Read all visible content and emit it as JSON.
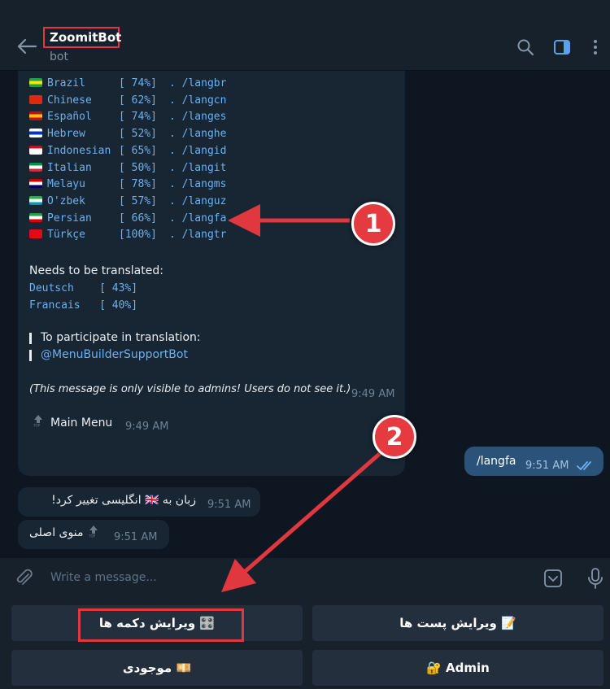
{
  "header": {
    "title": "ZoomitBot",
    "subtitle": "bot"
  },
  "languages": [
    {
      "name": "Brazil",
      "pct": "[ 74%]",
      "cmd": ". /langbr",
      "flag": [
        "#229e45",
        "#f8e509",
        "#229e45"
      ]
    },
    {
      "name": "Chinese",
      "pct": "[ 62%]",
      "cmd": ". /langcn",
      "flag": [
        "#de2910",
        "#de2910",
        "#de2910"
      ]
    },
    {
      "name": "Español",
      "pct": "[ 74%]",
      "cmd": ". /langes",
      "flag": [
        "#c60b1e",
        "#ffc400",
        "#c60b1e"
      ]
    },
    {
      "name": "Hebrew",
      "pct": "[ 52%]",
      "cmd": ". /langhe",
      "flag": [
        "#ffffff",
        "#0038b8",
        "#ffffff"
      ]
    },
    {
      "name": "Indonesian",
      "pct": "[ 65%]",
      "cmd": ". /langid",
      "flag": [
        "#e70011",
        "#ffffff",
        "#ffffff"
      ]
    },
    {
      "name": "Italian",
      "pct": "[ 50%]",
      "cmd": ". /langit",
      "flag": [
        "#009246",
        "#ffffff",
        "#ce2b37"
      ]
    },
    {
      "name": "Melayu",
      "pct": "[ 78%]",
      "cmd": ". /langms",
      "flag": [
        "#cc0001",
        "#ffffff",
        "#010066"
      ]
    },
    {
      "name": "O'zbek",
      "pct": "[ 57%]",
      "cmd": ". /languz",
      "flag": [
        "#1eb53a",
        "#ffffff",
        "#0099b5"
      ]
    },
    {
      "name": "Persian",
      "pct": "[ 66%]",
      "cmd": ". /langfa",
      "flag": [
        "#239f40",
        "#ffffff",
        "#da0000"
      ]
    },
    {
      "name": "Türkçe",
      "pct": "[100%]",
      "cmd": ". /langtr",
      "flag": [
        "#e30a17",
        "#e30a17",
        "#e30a17"
      ]
    }
  ],
  "needs_title": "Needs to be translated:",
  "needs": [
    {
      "name": "Deutsch",
      "pct": "[ 43%]"
    },
    {
      "name": "Francais",
      "pct": "[ 40%]"
    }
  ],
  "participate": "To participate in translation:",
  "support_bot": "@MenuBuilderSupportBot",
  "admin_note": "(This message is only visible to admins! Users do not see it.)",
  "time_1": "9:49 AM",
  "main_menu": "Main Menu",
  "time_2": "9:49 AM",
  "out_msg": "/langfa",
  "time_3": "9:51 AM",
  "changed_msg": "زبان به 🇬🇧 انگلیسی تغییر کرد!",
  "time_4": "9:51 AM",
  "main_menu_fa": "منوی اصلی",
  "time_5": "9:51 AM",
  "compose_placeholder": "Write a message...",
  "keyboard": {
    "edit_buttons": "ویرایش دکمه ها 🎛️",
    "edit_posts": "ویرایش پست ها 📝",
    "balance": "موجودی 💴",
    "admin": "🔐 Admin"
  },
  "badges": {
    "one": "1",
    "two": "2"
  },
  "colors": {
    "annotation_red": "#e0383e",
    "link_blue": "#6ab2f2",
    "outgoing_bubble": "#2b5278"
  }
}
